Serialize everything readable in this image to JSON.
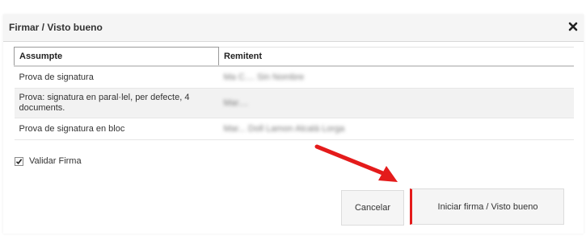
{
  "dialog": {
    "title": "Firmar / Visto bueno",
    "close_icon": "close-icon"
  },
  "table": {
    "headers": [
      "Assumpte",
      "Remitent"
    ],
    "rows": [
      {
        "subject": "Prova de signatura",
        "sender": "Ma C.... Sin Nombre"
      },
      {
        "subject": "Prova: signatura en paral·lel, per defecte, 4 documents.",
        "sender": "Mar...."
      },
      {
        "subject": "Prova de signatura en bloc",
        "sender": "Mar... Doll Lamon Alcalá Lorga"
      }
    ]
  },
  "validate": {
    "label": "Validar Firma",
    "checked": true
  },
  "buttons": {
    "cancel": "Cancelar",
    "start": "Iniciar firma / Visto bueno"
  },
  "colors": {
    "accent": "#e41b1b",
    "header_bg": "#f5f5f5"
  }
}
